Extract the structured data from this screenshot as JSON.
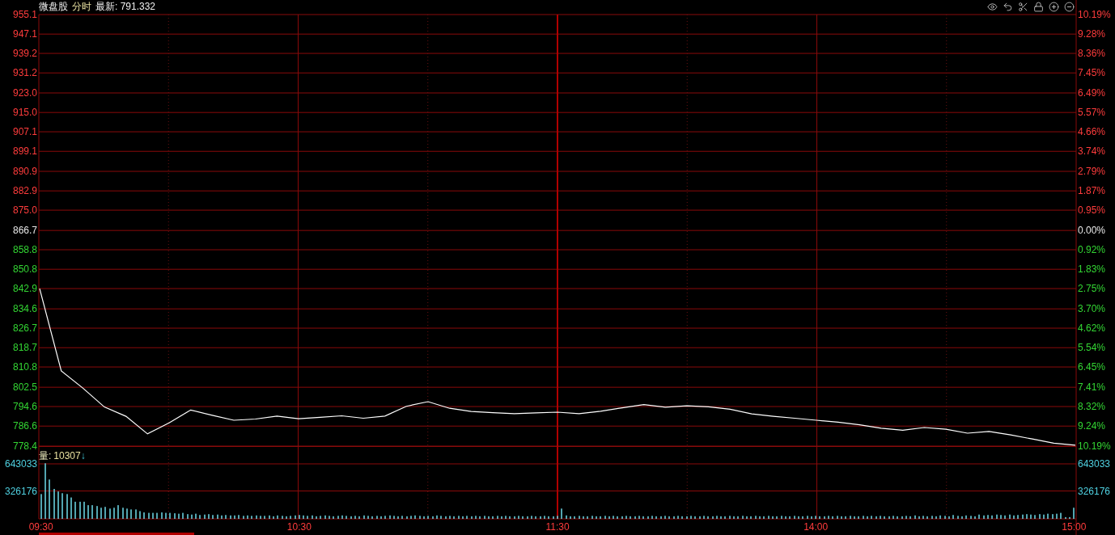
{
  "header": {
    "name": "微盘股",
    "period": "分时",
    "latest": "最新: 791.332"
  },
  "price_panel": {
    "right_axis_labels": [
      "10.19%",
      "9.28%",
      "8.36%",
      "7.45%",
      "6.49%",
      "5.57%",
      "4.66%",
      "3.74%",
      "2.79%",
      "1.87%",
      "0.95%",
      "0.00%",
      "0.92%",
      "1.83%",
      "2.75%",
      "3.70%",
      "4.62%",
      "5.54%",
      "6.45%",
      "7.41%",
      "8.32%",
      "9.24%",
      "10.19%"
    ],
    "chart_data": {
      "type": "line",
      "grid": true,
      "ylim": [
        778.4,
        955.1
      ],
      "yticks": [
        {
          "value": 955.1,
          "label": "955.1"
        },
        {
          "value": 947.1,
          "label": "947.1"
        },
        {
          "value": 939.2,
          "label": "939.2"
        },
        {
          "value": 931.2,
          "label": "931.2"
        },
        {
          "value": 923.0,
          "label": "923.0"
        },
        {
          "value": 915.0,
          "label": "915.0"
        },
        {
          "value": 907.1,
          "label": "907.1"
        },
        {
          "value": 899.1,
          "label": "899.1"
        },
        {
          "value": 890.9,
          "label": "890.9"
        },
        {
          "value": 882.9,
          "label": "882.9"
        },
        {
          "value": 875.0,
          "label": "875.0"
        },
        {
          "value": 866.7,
          "label": "866.7"
        },
        {
          "value": 858.8,
          "label": "858.8"
        },
        {
          "value": 850.8,
          "label": "850.8"
        },
        {
          "value": 842.9,
          "label": "842.9"
        },
        {
          "value": 834.6,
          "label": "834.6"
        },
        {
          "value": 826.7,
          "label": "826.7"
        },
        {
          "value": 818.7,
          "label": "818.7"
        },
        {
          "value": 810.8,
          "label": "810.8"
        },
        {
          "value": 802.5,
          "label": "802.5"
        },
        {
          "value": 794.6,
          "label": "794.6"
        },
        {
          "value": 786.6,
          "label": "786.6"
        },
        {
          "value": 778.4,
          "label": "778.4"
        }
      ],
      "categories": [
        null,
        null,
        null,
        null,
        null,
        null,
        null,
        null,
        null,
        null,
        null,
        null,
        null,
        null,
        null,
        null,
        null,
        null,
        null,
        null,
        null,
        null,
        null,
        null,
        null,
        null,
        null,
        null,
        null,
        null,
        null,
        null,
        null,
        null,
        null,
        null,
        null,
        null,
        null,
        null,
        null,
        null,
        null,
        null,
        null,
        null,
        null,
        null,
        null
      ],
      "series": [
        {
          "color": "#ffffff",
          "values": [
            842.9,
            809.2,
            802.2,
            794.4,
            790.6,
            783.4,
            787.9,
            793.2,
            791.0,
            789.0,
            789.5,
            790.7,
            789.6,
            790.2,
            790.8,
            789.8,
            790.7,
            794.7,
            796.6,
            793.9,
            792.6,
            792.1,
            791.7,
            792.0,
            792.3,
            791.7,
            792.7,
            794.1,
            795.4,
            794.3,
            794.9,
            794.5,
            793.5,
            791.6,
            790.6,
            789.8,
            789.0,
            788.2,
            787.1,
            785.7,
            784.9,
            786.0,
            785.3,
            783.7,
            784.4,
            783.0,
            781.3,
            779.6,
            778.8
          ]
        }
      ]
    }
  },
  "volume_panel": {
    "legend": {
      "label": "量:",
      "value": "10307",
      "arrow": "↓"
    },
    "right_axis_labels": [
      "643033",
      "326176"
    ],
    "chart_data": {
      "type": "bar",
      "grid": true,
      "ylim": [
        0,
        851000
      ],
      "yticks": [
        643033,
        326176
      ],
      "categories": [
        "09:30",
        null,
        null,
        null,
        null,
        null,
        null,
        null,
        null,
        null,
        null,
        null,
        null,
        null,
        null,
        null,
        null,
        null,
        null,
        null,
        null,
        null,
        null,
        null,
        null,
        null,
        null,
        null,
        null,
        null,
        null,
        null,
        null,
        null,
        null,
        null,
        null,
        null,
        null,
        null,
        null,
        null,
        null,
        null,
        null,
        null,
        null,
        null,
        null,
        null,
        null,
        null,
        null,
        null,
        null,
        null,
        null,
        null,
        null,
        null,
        "10:30",
        null,
        null,
        null,
        null,
        null,
        null,
        null,
        null,
        null,
        null,
        null,
        null,
        null,
        null,
        null,
        null,
        null,
        null,
        null,
        null,
        null,
        null,
        null,
        null,
        null,
        null,
        null,
        null,
        null,
        null,
        null,
        null,
        null,
        null,
        null,
        null,
        null,
        null,
        null,
        null,
        null,
        null,
        null,
        null,
        null,
        null,
        null,
        null,
        null,
        null,
        null,
        null,
        null,
        null,
        null,
        null,
        null,
        null,
        null,
        "11:30",
        null,
        null,
        null,
        null,
        null,
        null,
        null,
        null,
        null,
        null,
        null,
        null,
        null,
        null,
        null,
        null,
        null,
        null,
        null,
        null,
        null,
        null,
        null,
        null,
        null,
        null,
        null,
        null,
        null,
        null,
        null,
        null,
        null,
        null,
        null,
        null,
        null,
        null,
        null,
        null,
        null,
        null,
        null,
        null,
        null,
        null,
        null,
        null,
        null,
        null,
        null,
        null,
        null,
        null,
        null,
        null,
        null,
        null,
        null,
        "14:00",
        null,
        null,
        null,
        null,
        null,
        null,
        null,
        null,
        null,
        null,
        null,
        null,
        null,
        null,
        null,
        null,
        null,
        null,
        null,
        null,
        null,
        null,
        null,
        null,
        null,
        null,
        null,
        null,
        null,
        null,
        null,
        null,
        null,
        null,
        null,
        null,
        null,
        null,
        null,
        null,
        null,
        null,
        null,
        null,
        null,
        null,
        null,
        null,
        null,
        null,
        null,
        null,
        null,
        null,
        null,
        null,
        null,
        null,
        null,
        "15:00"
      ],
      "series": [
        {
          "color": "#6fdcea",
          "values": [
            290000,
            650000,
            460000,
            350000,
            320000,
            300000,
            290000,
            250000,
            200000,
            200000,
            200000,
            160000,
            160000,
            150000,
            130000,
            140000,
            120000,
            130000,
            160000,
            130000,
            120000,
            110000,
            110000,
            90000,
            75000,
            70000,
            70000,
            70000,
            75000,
            70000,
            70000,
            65000,
            60000,
            70000,
            55000,
            50000,
            60000,
            45000,
            50000,
            55000,
            45000,
            50000,
            40000,
            45000,
            40000,
            40000,
            45000,
            35000,
            40000,
            35000,
            40000,
            35000,
            35000,
            40000,
            30000,
            40000,
            35000,
            30000,
            35000,
            40000,
            45000,
            40000,
            35000,
            40000,
            30000,
            35000,
            40000,
            35000,
            30000,
            35000,
            40000,
            35000,
            30000,
            35000,
            30000,
            40000,
            35000,
            30000,
            35000,
            30000,
            35000,
            40000,
            35000,
            30000,
            35000,
            30000,
            35000,
            40000,
            35000,
            30000,
            35000,
            30000,
            40000,
            35000,
            30000,
            35000,
            30000,
            35000,
            30000,
            35000,
            30000,
            35000,
            30000,
            35000,
            30000,
            30000,
            35000,
            30000,
            35000,
            30000,
            30000,
            35000,
            30000,
            30000,
            35000,
            30000,
            30000,
            35000,
            30000,
            30000,
            35000,
            120000,
            40000,
            30000,
            30000,
            35000,
            30000,
            30000,
            35000,
            30000,
            30000,
            35000,
            30000,
            35000,
            30000,
            30000,
            35000,
            30000,
            30000,
            35000,
            30000,
            30000,
            35000,
            30000,
            30000,
            35000,
            30000,
            30000,
            35000,
            30000,
            30000,
            35000,
            30000,
            30000,
            35000,
            30000,
            30000,
            35000,
            30000,
            30000,
            35000,
            30000,
            30000,
            35000,
            30000,
            30000,
            35000,
            30000,
            30000,
            35000,
            30000,
            30000,
            35000,
            30000,
            30000,
            35000,
            30000,
            30000,
            35000,
            30000,
            35000,
            30000,
            30000,
            35000,
            30000,
            35000,
            30000,
            30000,
            35000,
            30000,
            30000,
            35000,
            30000,
            35000,
            30000,
            35000,
            30000,
            30000,
            35000,
            30000,
            30000,
            35000,
            30000,
            40000,
            30000,
            35000,
            30000,
            35000,
            30000,
            40000,
            35000,
            30000,
            45000,
            35000,
            30000,
            40000,
            35000,
            30000,
            50000,
            40000,
            45000,
            40000,
            50000,
            45000,
            40000,
            50000,
            40000,
            45000,
            50000,
            55000,
            50000,
            45000,
            55000,
            50000,
            60000,
            55000,
            60000,
            70000,
            20000,
            20000,
            130000
          ]
        }
      ]
    }
  }
}
